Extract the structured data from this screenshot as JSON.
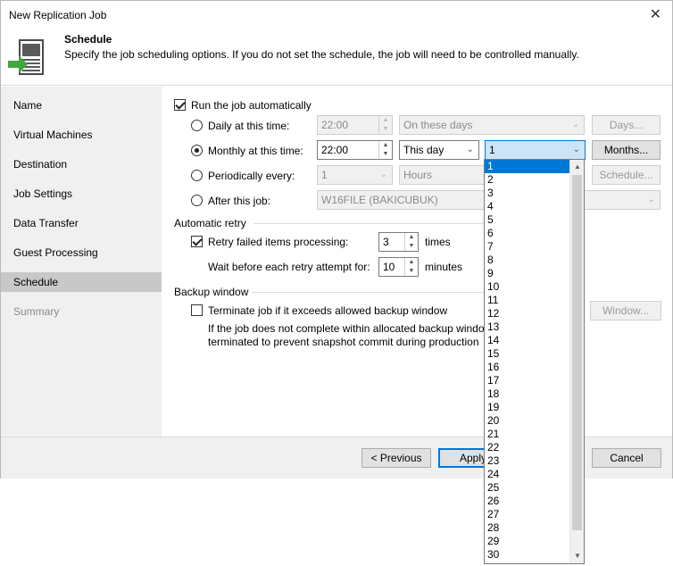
{
  "window": {
    "title": "New Replication Job",
    "close_glyph": "✕"
  },
  "header": {
    "title": "Schedule",
    "description": "Specify the job scheduling options. If you do not set the schedule, the job will need to be controlled manually."
  },
  "nav": {
    "items": [
      {
        "label": "Name"
      },
      {
        "label": "Virtual Machines"
      },
      {
        "label": "Destination"
      },
      {
        "label": "Job Settings"
      },
      {
        "label": "Data Transfer"
      },
      {
        "label": "Guest Processing"
      },
      {
        "label": "Schedule"
      },
      {
        "label": "Summary"
      }
    ]
  },
  "schedule": {
    "run_automatically": "Run the job automatically",
    "daily": {
      "label": "Daily at this time:",
      "time": "22:00",
      "days_value": "On these days",
      "button": "Days..."
    },
    "monthly": {
      "label": "Monthly at this time:",
      "time": "22:00",
      "day_type": "This day",
      "day_number": "1",
      "button": "Months..."
    },
    "periodic": {
      "label": "Periodically every:",
      "value": "1",
      "unit": "Hours",
      "button": "Schedule..."
    },
    "after": {
      "label": "After this job:",
      "value": "W16FILE (BAKICUBUK)"
    }
  },
  "retry": {
    "group": "Automatic retry",
    "failed_label": "Retry failed items processing:",
    "failed_value": "3",
    "failed_unit": "times",
    "wait_label": "Wait before each retry attempt for:",
    "wait_value": "10",
    "wait_unit": "minutes"
  },
  "backup_window": {
    "group": "Backup window",
    "terminate_label": "Terminate job if it exceeds allowed backup window",
    "desc_line1": "If the job does not complete within allocated backup windo",
    "desc_line2": "terminated to prevent snapshot commit during production",
    "button": "Window..."
  },
  "footer": {
    "previous": "< Previous",
    "apply": "Apply"
  },
  "dropdown": {
    "options": [
      "1",
      "2",
      "3",
      "4",
      "5",
      "6",
      "7",
      "8",
      "9",
      "10",
      "11",
      "12",
      "13",
      "14",
      "15",
      "16",
      "17",
      "18",
      "19",
      "20",
      "21",
      "22",
      "23",
      "24",
      "25",
      "26",
      "27",
      "28",
      "29",
      "30"
    ]
  },
  "glyphs": {
    "spin_up": "▲",
    "spin_down": "▼",
    "arrow_down": "⌄"
  }
}
